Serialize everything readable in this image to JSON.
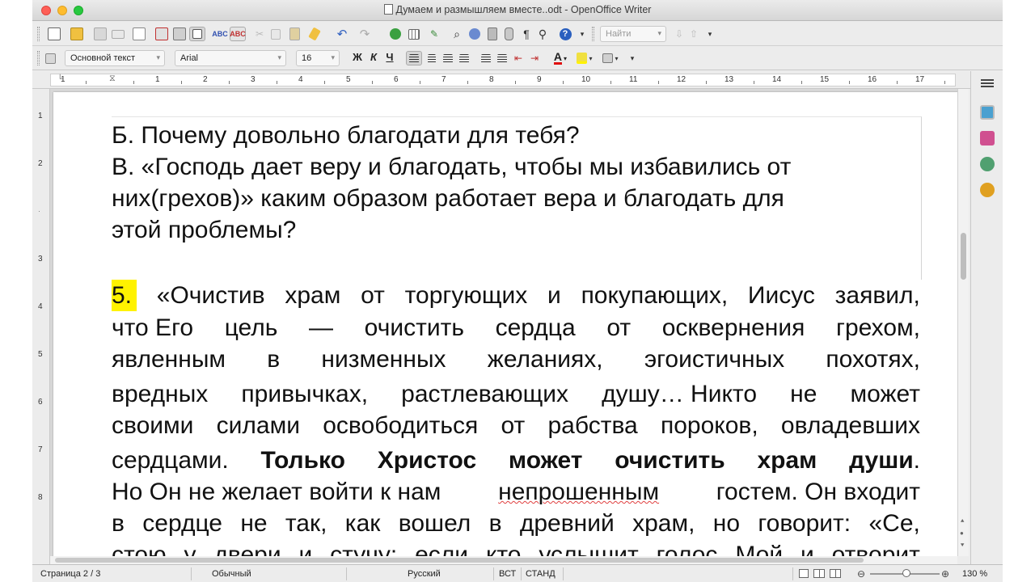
{
  "window": {
    "title": "Думаем и размышляем вместе..odt - OpenOffice Writer"
  },
  "toolbar_formatting": {
    "paragraph_style": "Основной текст",
    "font_name": "Arial",
    "font_size": "16",
    "bold_label": "Ж",
    "italic_label": "К",
    "underline_label": "Ч"
  },
  "toolbar_standard": {
    "find_placeholder": "Найти"
  },
  "ruler": {
    "h_numbers": [
      "1",
      "1",
      "2",
      "3",
      "4",
      "5",
      "6",
      "7",
      "8",
      "9",
      "10",
      "11",
      "12",
      "13",
      "14",
      "15",
      "16",
      "17"
    ],
    "v_numbers": [
      "1",
      "2",
      "3",
      "4",
      "5",
      "6",
      "7",
      "8"
    ]
  },
  "document": {
    "line_b": "Б. Почему довольно благодати для тебя?",
    "line_v1": "В.  «Господь дает веру и благодать, чтобы мы избавились от",
    "line_v2": "них(грехов)» каким образом работает вера и благодать для",
    "line_v3": "этой проблемы?",
    "p5_number": "5.",
    "p5_line1": [
      "«Очистив",
      "храм",
      "от",
      "торгующих",
      "и",
      "покупающих,",
      "Иисус",
      "заявил,"
    ],
    "p5_line2": [
      "что Его",
      "цель",
      "—",
      "очистить",
      "сердца",
      "от",
      "осквернения",
      "грехом,"
    ],
    "p5_line3": [
      "явленным",
      "в",
      "низменных",
      "желаниях,",
      "эгоистичных",
      "похотях,"
    ],
    "p5_line4": [
      "вредных",
      "привычках,",
      "растлевающих",
      "душу… Никто",
      "не",
      "может"
    ],
    "p5_line5": [
      "своими",
      "силами",
      "освободиться",
      "от",
      "рабства",
      "пороков,",
      "овладевших"
    ],
    "p5_line6_start": "сердцами.",
    "p5_line6_bold": [
      "Только",
      "Христос",
      "может",
      "очистить",
      "храм",
      "души"
    ],
    "p5_line6_end": ".",
    "p5_line7_a": "Но Он не желает войти к нам",
    "p5_line7_misspelled": "непрошенным",
    "p5_line7_b": "гостем. Он входит",
    "p5_line8": [
      "в",
      "сердце",
      "не",
      "так,",
      "как",
      "вошел",
      "в",
      "древний",
      "храм,",
      "но",
      "говорит:",
      "«Се,"
    ],
    "p5_line9": [
      "стою",
      "у",
      "двери",
      "и",
      "стучу:",
      "если",
      "кто",
      "услышит",
      "голос",
      "Мой",
      "и",
      "отворит"
    ]
  },
  "status": {
    "page": "Страница  2 / 3",
    "style": "Обычный",
    "language": "Русский",
    "insert_mode": "ВСТ",
    "selection_mode": "СТАНД",
    "zoom": "130 %"
  },
  "colors": {
    "highlight": "#fff200",
    "spell_error": "#e04040"
  }
}
